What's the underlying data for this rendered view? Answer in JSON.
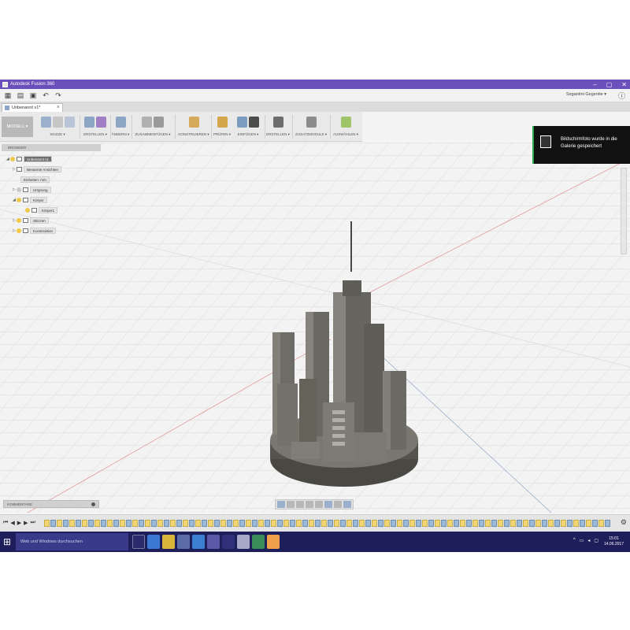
{
  "window": {
    "title": "Autodesk Fusion 360",
    "controls": [
      "–",
      "▢",
      "✕"
    ]
  },
  "quickaccess": {
    "user_label": "Segantini Gegentie ▾",
    "help_icon": "help-icon"
  },
  "document_tab": {
    "label": "Unbenannt v1*",
    "close": "×"
  },
  "ribbon": {
    "mode": "MODELL ▾",
    "groups": [
      {
        "label": "SKIZZE ▾"
      },
      {
        "label": "ERSTELLEN ▾"
      },
      {
        "label": "ÄNDERN ▾"
      },
      {
        "label": "ZUSAMMENFÜGEN ▾"
      },
      {
        "label": "KONSTRUIEREN ▾"
      },
      {
        "label": "PRÜFEN ▾"
      },
      {
        "label": "EINFÜGEN ▾"
      },
      {
        "label": "ERSTELLEN ▾"
      },
      {
        "label": "ZUSATZMODULE ▾"
      },
      {
        "label": "AUSWÄHLEN ▾"
      }
    ]
  },
  "browser": {
    "header": "BROWSER",
    "items": [
      {
        "label": "Unbenannt v1"
      },
      {
        "label": "Benannte Ansichten"
      },
      {
        "label": "Einheiten: mm"
      },
      {
        "label": "Ursprung"
      },
      {
        "label": "Körper"
      },
      {
        "label": "Körper1"
      },
      {
        "label": "Skizzen"
      },
      {
        "label": "Konstruktion"
      }
    ]
  },
  "toast": {
    "text": "Bildschirmfoto wurde in die Galerie gespeichert"
  },
  "comments": {
    "label": "KOMMENTARE"
  },
  "taskbar": {
    "search_placeholder": "Web und Windows durchsuchen",
    "time": "15:01",
    "date": "14.06.2017"
  },
  "colors": {
    "titlebar": "#6b4fbb",
    "taskbar": "#1e1e5a",
    "toast_accent": "#2fa94e",
    "model": "#6c6a64"
  }
}
